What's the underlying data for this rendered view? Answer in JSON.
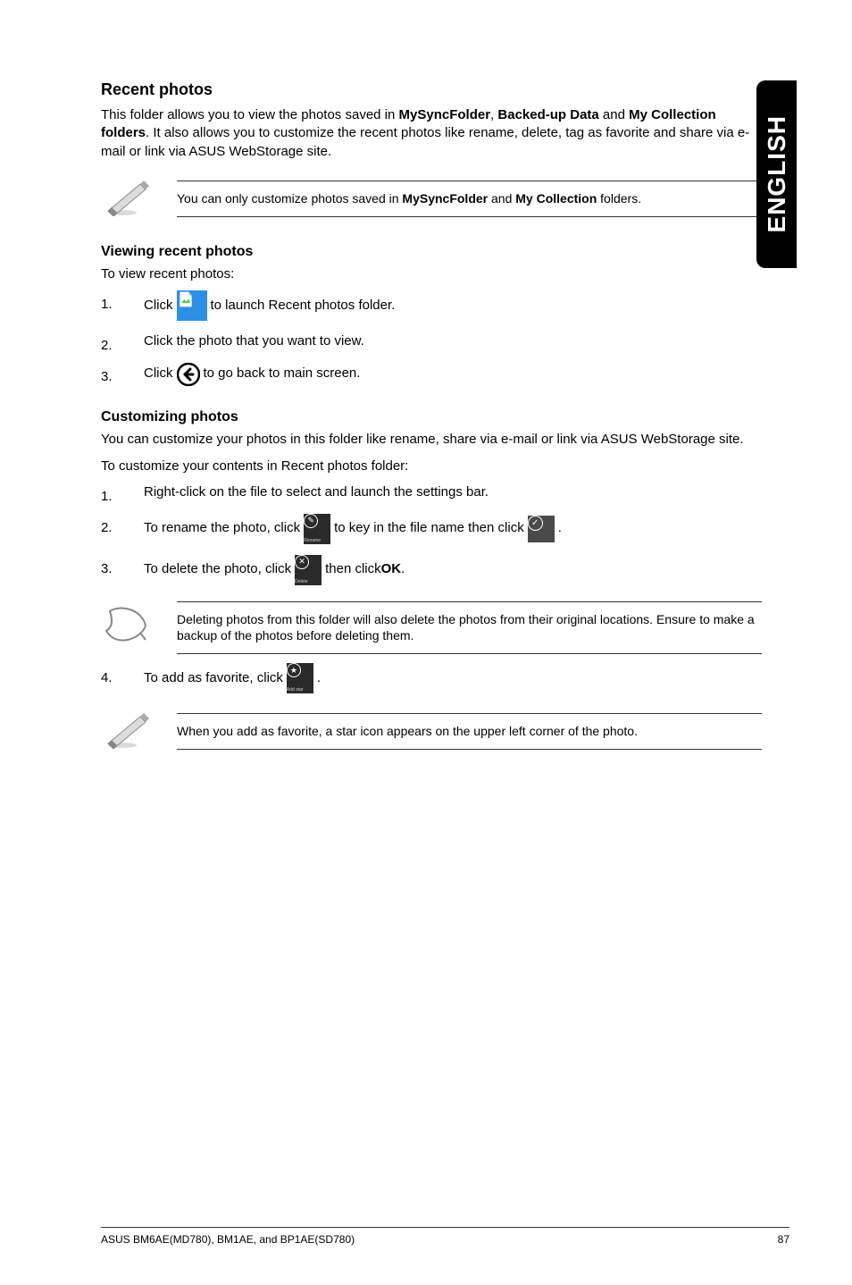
{
  "sidebar": {
    "label": "ENGLISH"
  },
  "section": {
    "title": "Recent photos",
    "intro_parts": [
      "This folder allows you to view the photos saved in ",
      "MySyncFolder",
      ", ",
      "Backed-up Data",
      " and ",
      "My Collection folders",
      ". It also allows you to customize the recent photos like rename, delete, tag as favorite and share via e-mail or link via ASUS WebStorage site."
    ]
  },
  "note1": [
    "You can only customize photos saved in ",
    "MySyncFolder",
    " and ",
    "My Collection",
    " folders."
  ],
  "viewing": {
    "title": "Viewing recent photos",
    "lead": "To view recent photos:",
    "steps": {
      "s1a": "Click ",
      "s1b": " to launch Recent photos folder.",
      "s2": "Click the photo that you want to view.",
      "s3a": "Click ",
      "s3b": " to go back to main screen."
    }
  },
  "customizing": {
    "title": "Customizing photos",
    "lead1": "You can customize your photos in this folder like rename, share via e-mail or link via ASUS WebStorage site.",
    "lead2": "To customize your contents in Recent photos folder:",
    "steps": {
      "s1": "Right-click on the file to select and launch the settings bar.",
      "s2a": "To rename the photo, click ",
      "s2b": " to key in the file name then click ",
      "s2c": ".",
      "s3a": "To delete the photo, click ",
      "s3b": " then click ",
      "s3c": "OK",
      "s3d": ".",
      "s4a": "To add as favorite, click ",
      "s4b": "."
    }
  },
  "note2": "Deleting photos from this folder will also delete the photos from their original locations. Ensure to make a backup of the photos before deleting them.",
  "note3": "When you add as favorite, a star icon appears on the upper left corner of the photo.",
  "icon_labels": {
    "rename": "Rename",
    "delete": "Delete",
    "addstar": "Add star"
  },
  "footer": {
    "left": "ASUS BM6AE(MD780), BM1AE, and BP1AE(SD780)",
    "right": "87"
  }
}
